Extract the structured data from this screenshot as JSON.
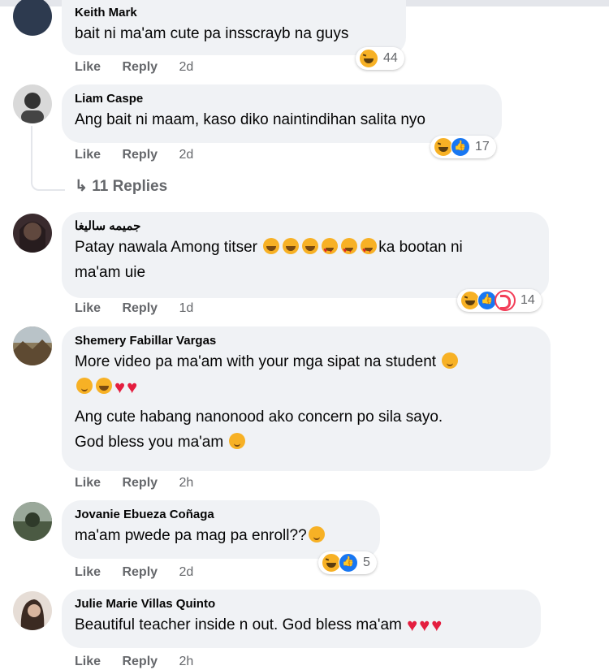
{
  "comments": [
    {
      "author": "Keith Mark",
      "lines": [
        "bait ni ma'am cute pa insscrayb na guys"
      ],
      "actions": {
        "like": "Like",
        "reply": "Reply",
        "time": "2d"
      },
      "reactions": {
        "icons": [
          "haha"
        ],
        "count": "44"
      }
    },
    {
      "author": "Liam Caspe",
      "lines": [
        "Ang bait ni maam, kaso diko naintindihan salita nyo"
      ],
      "actions": {
        "like": "Like",
        "reply": "Reply",
        "time": "2d"
      },
      "reactions": {
        "icons": [
          "haha",
          "like"
        ],
        "count": "17"
      },
      "replies_label": "11 Replies"
    },
    {
      "author": "جميمه ساليغا",
      "lines": [
        "Patay nawala Among titser",
        "ka bootan ni",
        "ma'am uie"
      ],
      "actions": {
        "like": "Like",
        "reply": "Reply",
        "time": "1d"
      },
      "reactions": {
        "icons": [
          "haha",
          "like",
          "care"
        ],
        "count": "14"
      }
    },
    {
      "author": "Shemery Fabillar Vargas",
      "lines": [
        "More video pa ma'am with your mga sipat na student",
        "Ang cute habang nanonood ako concern po sila sayo.",
        "God bless you ma'am"
      ],
      "actions": {
        "like": "Like",
        "reply": "Reply",
        "time": "2h"
      }
    },
    {
      "author": "Jovanie Ebueza Coñaga",
      "lines": [
        "ma'am pwede pa mag pa enroll??"
      ],
      "actions": {
        "like": "Like",
        "reply": "Reply",
        "time": "2d"
      },
      "reactions": {
        "icons": [
          "haha",
          "like"
        ],
        "count": "5"
      }
    },
    {
      "author": "Julie Marie Villas Quinto",
      "lines": [
        "Beautiful teacher inside n out. God bless ma'am"
      ],
      "actions": {
        "like": "Like",
        "reply": "Reply",
        "time": "2h"
      }
    }
  ],
  "colors": {
    "bubble": "#f0f2f5",
    "muted": "#65676b",
    "like_blue": "#1877f2",
    "heart_red": "#e41e3f",
    "haha_yellow": "#f7b125"
  }
}
